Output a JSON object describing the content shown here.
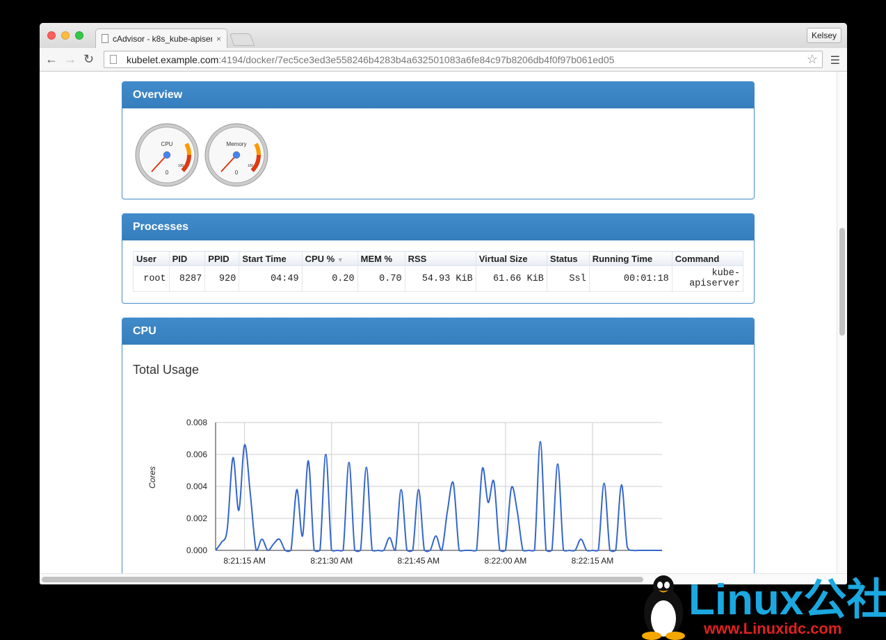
{
  "browser": {
    "tab_title": "cAdvisor - k8s_kube-apiser",
    "tab_close": "×",
    "profile_name": "Kelsey",
    "url_host": "kubelet.example.com",
    "url_path": ":4194/docker/7ec5ce3ed3e558246b4283b4a632501083a6fe84c97b8206db4f0f97b061ed05",
    "icons": [
      "back-icon",
      "forward-icon",
      "reload-icon",
      "page-icon",
      "star-icon",
      "menu-icon"
    ]
  },
  "overview": {
    "heading": "Overview",
    "gauges": [
      {
        "label": "CPU",
        "min": "0",
        "max": "100",
        "value": 0
      },
      {
        "label": "Memory",
        "min": "0",
        "max": "100",
        "value": 0
      }
    ]
  },
  "processes": {
    "heading": "Processes",
    "columns": [
      "User",
      "PID",
      "PPID",
      "Start Time",
      "CPU %",
      "MEM %",
      "RSS",
      "Virtual Size",
      "Status",
      "Running Time",
      "Command"
    ],
    "sorted_column": "CPU %",
    "rows": [
      [
        "root",
        "8287",
        "920",
        "04:49",
        "0.20",
        "0.70",
        "54.93 KiB",
        "61.66 KiB",
        "Ssl",
        "00:01:18",
        "kube-\napiserver"
      ]
    ]
  },
  "cpu": {
    "heading": "CPU",
    "subtitle": "Total Usage"
  },
  "chart_data": {
    "type": "line",
    "title": "Total Usage",
    "ylabel": "Cores",
    "xlabel": "",
    "ylim": [
      0,
      0.008
    ],
    "yticks": [
      "0.000",
      "0.002",
      "0.004",
      "0.006",
      "0.008"
    ],
    "xticks": [
      "8:21:15 AM",
      "8:21:30 AM",
      "8:21:45 AM",
      "8:22:00 AM",
      "8:22:15 AM"
    ],
    "grid": true,
    "series": [
      {
        "color": "#3366cc",
        "x_seconds_after_8_21_10": [
          0,
          1,
          2,
          3,
          4,
          5,
          6,
          7,
          8,
          9,
          10,
          11,
          12,
          13,
          14,
          15,
          16,
          17,
          18,
          19,
          20,
          21,
          22,
          23,
          24,
          25,
          26,
          27,
          28,
          29,
          30,
          31,
          32,
          33,
          34,
          35,
          36,
          37,
          38,
          39,
          40,
          41,
          42,
          43,
          44,
          45,
          46,
          47,
          48,
          49,
          50,
          51,
          52,
          53,
          54,
          55,
          56,
          57,
          58,
          59,
          60,
          61,
          62,
          63,
          64,
          65,
          66,
          67,
          68,
          69,
          70,
          71,
          72,
          73,
          74,
          75,
          76,
          77
        ],
        "values": [
          0.0,
          0.0005,
          0.0013,
          0.0058,
          0.0025,
          0.0066,
          0.0035,
          0.0,
          0.0007,
          0.0,
          0.0004,
          0.0007,
          0.0,
          0.0,
          0.0038,
          0.0009,
          0.0056,
          0.0,
          0.0,
          0.006,
          0.0,
          0.0,
          0.0,
          0.0055,
          0.0,
          0.0,
          0.0052,
          0.0,
          0.0,
          0.0,
          0.0008,
          0.0,
          0.0038,
          0.0,
          0.0,
          0.0038,
          0.0,
          0.0,
          0.0009,
          0.0,
          0.0025,
          0.0042,
          0.0,
          0.0,
          0.0,
          0.0,
          0.0051,
          0.003,
          0.0043,
          0.0,
          0.0,
          0.0039,
          0.0025,
          0.0,
          0.0,
          0.0,
          0.0068,
          0.0,
          0.0,
          0.0054,
          0.0,
          0.0,
          0.0,
          0.0007,
          0.0,
          0.0,
          0.0,
          0.0042,
          0.0,
          0.0,
          0.0041,
          0.0002,
          0.0,
          0.0,
          0.0,
          0.0,
          0.0,
          0.0
        ]
      }
    ]
  },
  "watermark": {
    "text": "Linux公社",
    "url": "www.Linuxidc.com"
  }
}
